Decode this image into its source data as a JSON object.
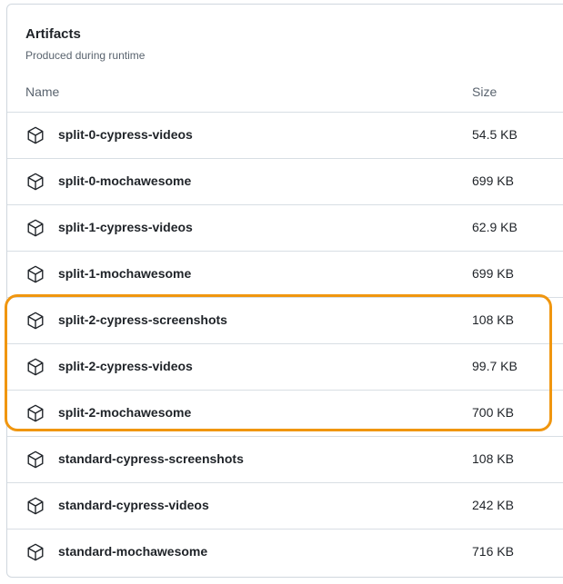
{
  "header": {
    "title": "Artifacts",
    "subtitle": "Produced during runtime"
  },
  "columns": {
    "name": "Name",
    "size": "Size"
  },
  "artifacts": [
    {
      "name": "split-0-cypress-videos",
      "size": "54.5 KB",
      "icon": "package-icon"
    },
    {
      "name": "split-0-mochawesome",
      "size": "699 KB",
      "icon": "package-icon"
    },
    {
      "name": "split-1-cypress-videos",
      "size": "62.9 KB",
      "icon": "package-icon"
    },
    {
      "name": "split-1-mochawesome",
      "size": "699 KB",
      "icon": "package-icon"
    },
    {
      "name": "split-2-cypress-screenshots",
      "size": "108 KB",
      "icon": "package-icon"
    },
    {
      "name": "split-2-cypress-videos",
      "size": "99.7 KB",
      "icon": "package-icon"
    },
    {
      "name": "split-2-mochawesome",
      "size": "700 KB",
      "icon": "package-icon"
    },
    {
      "name": "standard-cypress-screenshots",
      "size": "108 KB",
      "icon": "package-icon"
    },
    {
      "name": "standard-cypress-videos",
      "size": "242 KB",
      "icon": "package-icon"
    },
    {
      "name": "standard-mochawesome",
      "size": "716 KB",
      "icon": "package-icon"
    }
  ],
  "highlight": {
    "color": "#f0960f",
    "rows": [
      "split-2-cypress-screenshots",
      "split-2-cypress-videos",
      "split-2-mochawesome"
    ]
  }
}
